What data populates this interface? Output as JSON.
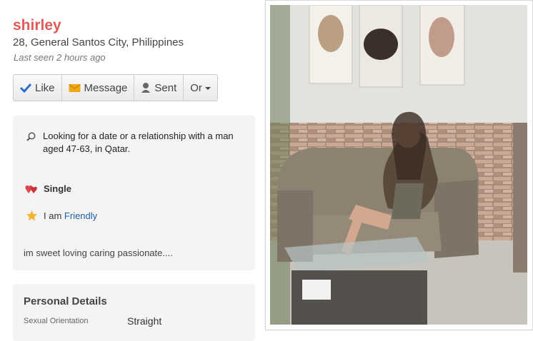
{
  "profile": {
    "name": "shirley",
    "location": "28, General Santos City, Philippines",
    "last_seen": "Last seen 2 hours ago"
  },
  "actions": {
    "like": "Like",
    "message": "Message",
    "sent": "Sent",
    "or": "Or"
  },
  "about": {
    "looking_line1": "Looking for a date or a relationship with a man",
    "looking_line2": "aged 47-63, in Qatar.",
    "status": "Single",
    "iam_prefix": "I am",
    "iam_value": "Friendly",
    "bio": "im sweet loving caring passionate...."
  },
  "personal_details": {
    "title": "Personal Details",
    "label": "Sexual Orientation",
    "value": "Straight"
  },
  "colors": {
    "accent": "#e05a5a",
    "link": "#1d5fa8"
  }
}
